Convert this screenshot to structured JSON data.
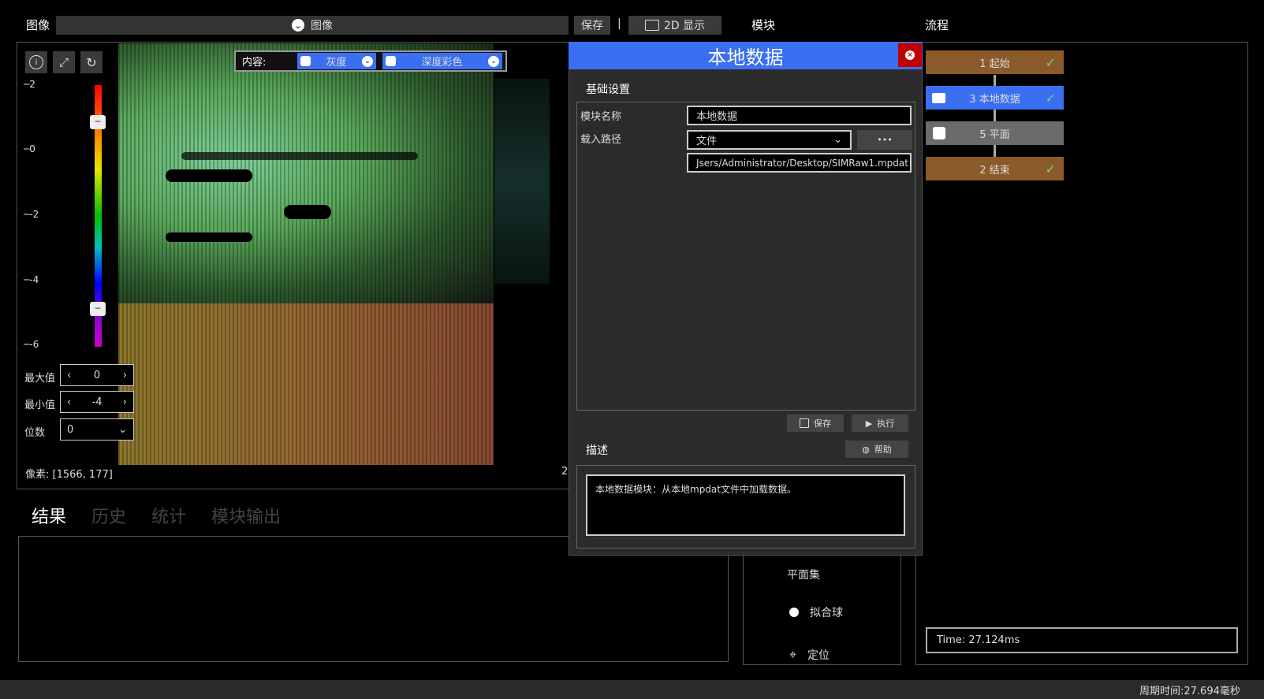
{
  "top": {
    "image_label": "图像",
    "image_dropdown": "图像",
    "save_label": "保存",
    "separator": "|",
    "view_label": "2D 显示",
    "modules_label": "模块",
    "flow_label": "流程"
  },
  "viewer": {
    "content_label": "内容:",
    "gray_label": "灰度",
    "depth_label": "深度彩色",
    "scale_ticks": [
      "2",
      "0",
      "-2",
      "-4",
      "-6"
    ],
    "max_label": "最大值",
    "max_value": "0",
    "min_label": "最小值",
    "min_value": "-4",
    "digits_label": "位数",
    "digits_value": "0",
    "pixel_info": "像素: [1566, 177]",
    "right_info": "2"
  },
  "result_tabs": [
    "结果",
    "历史",
    "统计",
    "模块输出"
  ],
  "dialog": {
    "title": "本地数据",
    "basic_settings": "基础设置",
    "module_name_label": "模块名称",
    "module_name_value": "本地数据",
    "load_path_label": "载入路径",
    "load_type": "文件",
    "browse_label": "•••",
    "path_value": "Jsers/Administrator/Desktop/SIMRaw1.mpdat",
    "save_label": "保存",
    "run_label": "执行",
    "description_label": "描述",
    "help_label": "帮助",
    "description_text": "本地数据模块：从本地mpdat文件中加载数据。"
  },
  "modules": {
    "items": [
      "平面集",
      "拟合球",
      "定位"
    ]
  },
  "flow": {
    "nodes": [
      {
        "label": "1 起始",
        "color": "#8a5a2b",
        "status": "done"
      },
      {
        "label": "3 本地数据",
        "color": "#3a6ff2",
        "status": "done"
      },
      {
        "label": "5 平面",
        "color": "#6b6b6b",
        "status": "pending"
      },
      {
        "label": "2 结束",
        "color": "#8a5a2b",
        "status": "done"
      }
    ],
    "time": "Time: 27.124ms"
  },
  "status_bar": {
    "cycle_time": "周期时间:27.694毫秒"
  },
  "colors": {
    "accent_blue": "#3a6ff2",
    "close_red": "#c00000",
    "flow_brown": "#8a5a2b"
  }
}
